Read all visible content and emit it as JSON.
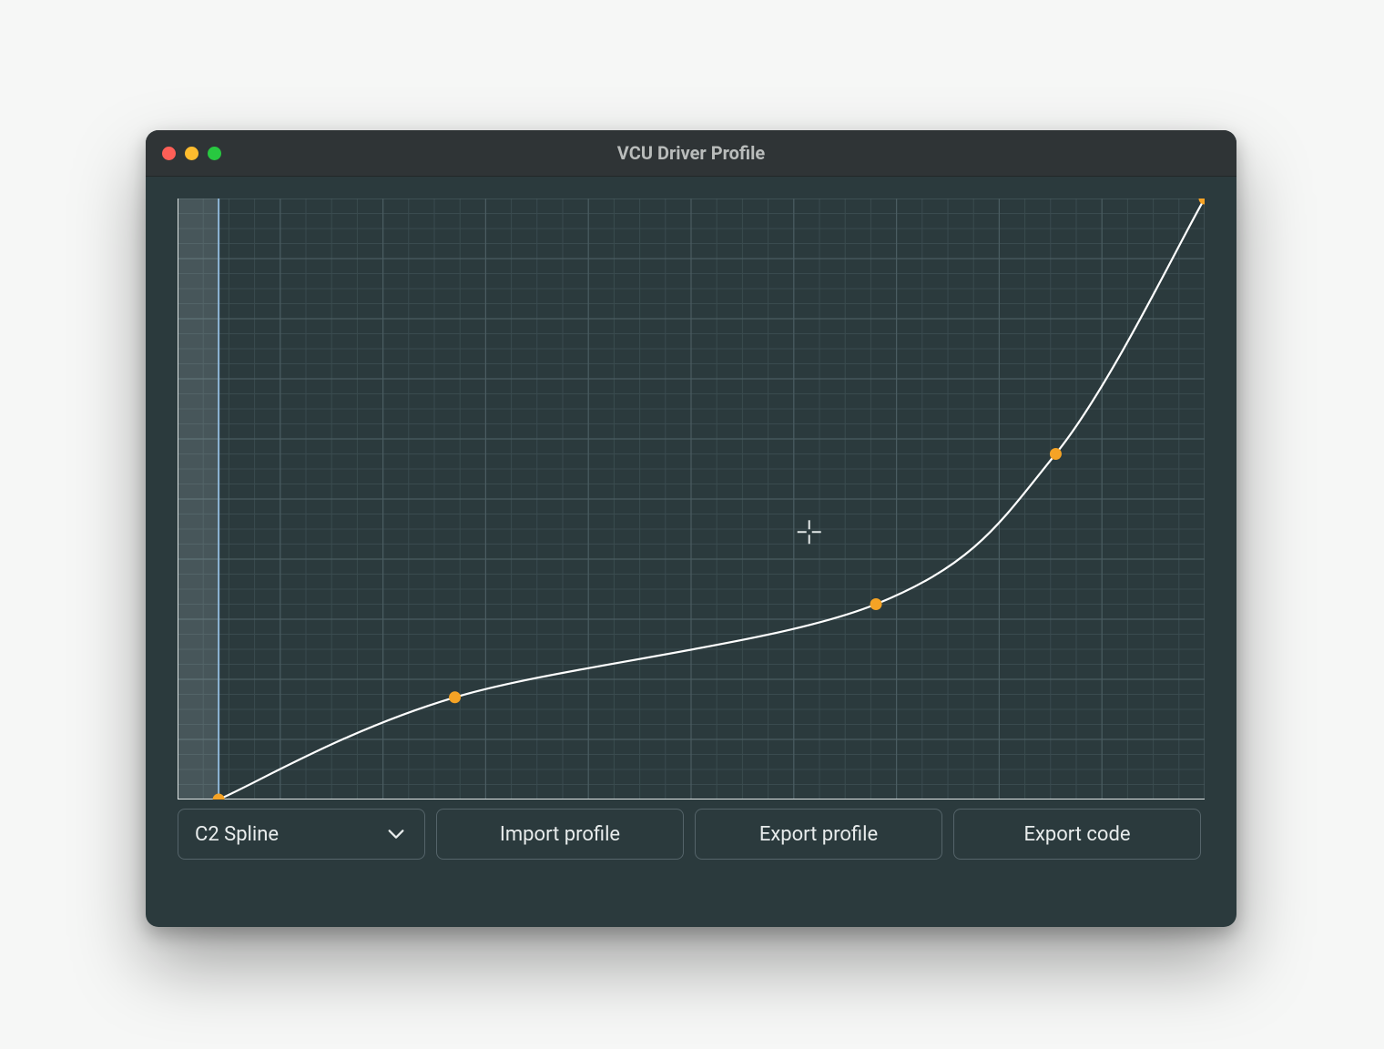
{
  "window": {
    "title": "VCU Driver Profile"
  },
  "toolbar": {
    "interpolation_label": "C2 Spline",
    "import_label": "Import profile",
    "export_profile_label": "Export profile",
    "export_code_label": "Export code"
  },
  "colors": {
    "bg": "#2b3a3d",
    "titlebar": "#2f3436",
    "grid_minor": "#3a4b4f",
    "grid_major": "#4a5c61",
    "axis": "#dfe5e5",
    "curve": "#ffffff",
    "point": "#f5a325",
    "crosshair": "#e4e9e9"
  },
  "chart_data": {
    "type": "line",
    "title": "",
    "xlabel": "",
    "ylabel": "",
    "xlim": [
      0,
      1
    ],
    "ylim": [
      0,
      1
    ],
    "major_step": 0.1,
    "minor_step": 0.025,
    "deadzone_x": 0.04,
    "points": [
      {
        "x": 0.04,
        "y": 0.0
      },
      {
        "x": 0.27,
        "y": 0.17
      },
      {
        "x": 0.68,
        "y": 0.325
      },
      {
        "x": 0.855,
        "y": 0.575
      },
      {
        "x": 1.0,
        "y": 1.0
      }
    ],
    "cursor": {
      "x": 0.615,
      "y": 0.445
    }
  }
}
